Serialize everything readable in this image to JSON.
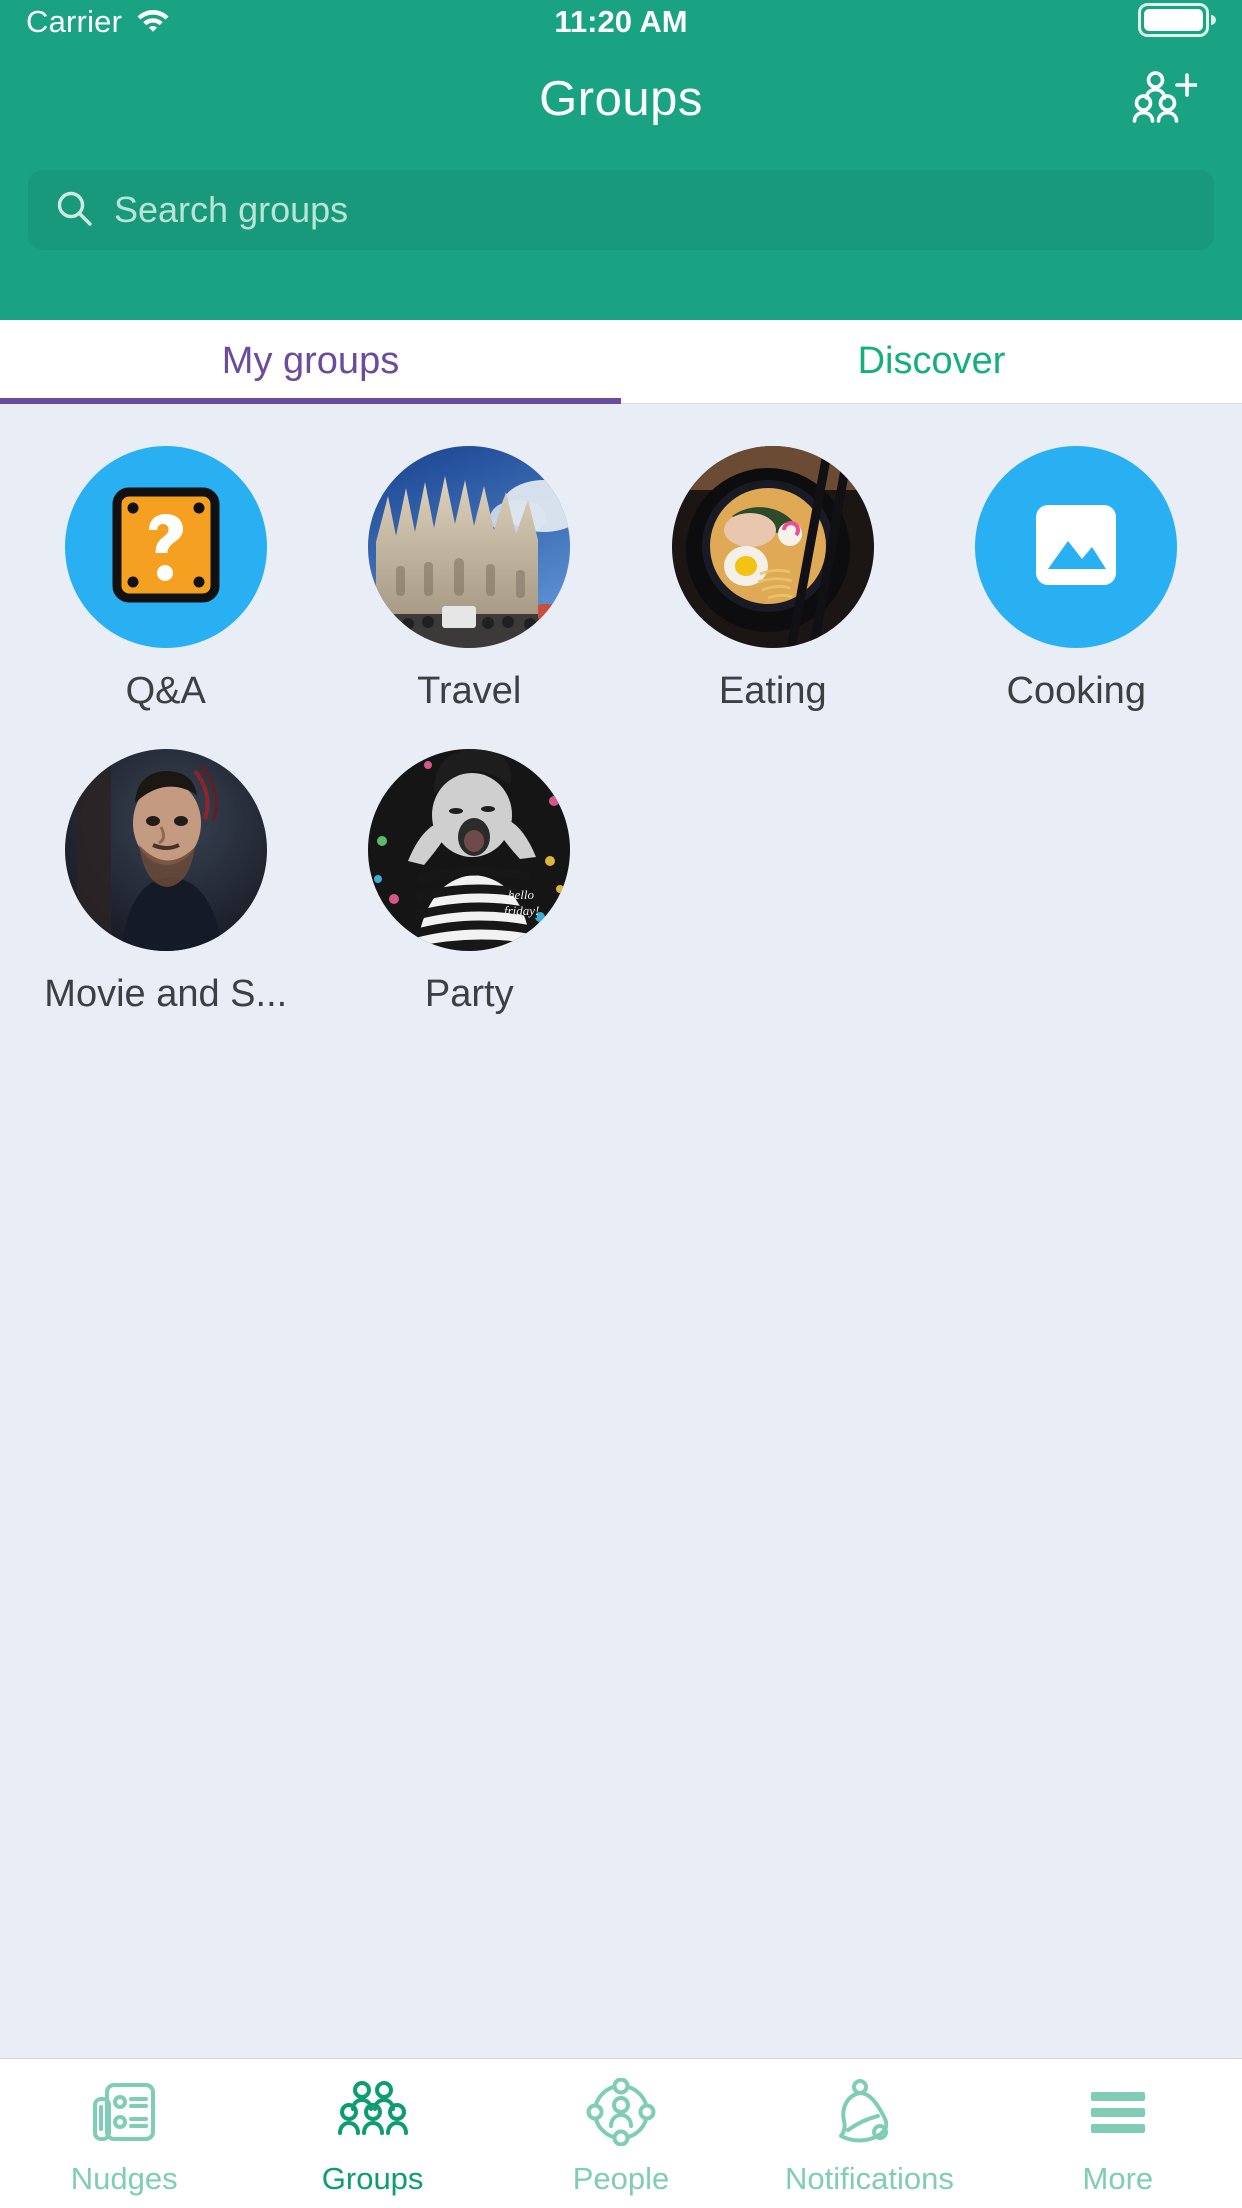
{
  "colors": {
    "brand_teal": "#19a382",
    "search_field": "#19997b",
    "tab_active_purple": "#6b4b9e",
    "tab_inactive_teal": "#13b07e",
    "content_bg": "#e9edf5",
    "avatar_blue": "#29b0f2",
    "tabbar_inactive": "#7fcdb6",
    "tabbar_active": "#0e9c72"
  },
  "status_bar": {
    "carrier": "Carrier",
    "wifi_icon": "wifi-icon",
    "time": "11:20 AM",
    "battery_icon": "battery-full-icon"
  },
  "header": {
    "title": "Groups",
    "add_group_icon": "add-group-icon"
  },
  "search": {
    "icon": "search-icon",
    "placeholder": "Search groups",
    "value": ""
  },
  "tabs": [
    {
      "label": "My groups",
      "active": true
    },
    {
      "label": "Discover",
      "active": false
    }
  ],
  "groups": [
    {
      "label": "Q&A",
      "avatar_type": "question-block-icon"
    },
    {
      "label": "Travel",
      "avatar_type": "photo-cathedral"
    },
    {
      "label": "Eating",
      "avatar_type": "photo-ramen"
    },
    {
      "label": "Cooking",
      "avatar_type": "image-placeholder-icon"
    },
    {
      "label": "Movie and S...",
      "avatar_type": "photo-man"
    },
    {
      "label": "Party",
      "avatar_type": "photo-child"
    }
  ],
  "tabbar": [
    {
      "label": "Nudges",
      "icon": "newspaper-icon",
      "active": false
    },
    {
      "label": "Groups",
      "icon": "people-group-icon",
      "active": true
    },
    {
      "label": "People",
      "icon": "person-network-icon",
      "active": false
    },
    {
      "label": "Notifications",
      "icon": "bell-icon",
      "active": false
    },
    {
      "label": "More",
      "icon": "hamburger-icon",
      "active": false
    }
  ]
}
